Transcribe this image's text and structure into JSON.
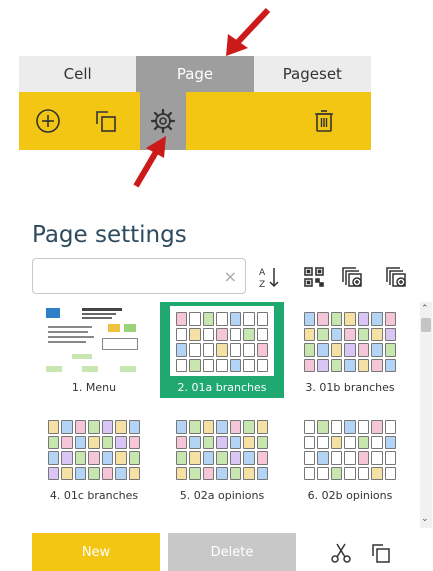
{
  "tabs": [
    {
      "label": "Cell"
    },
    {
      "label": "Page"
    },
    {
      "label": "Pageset"
    }
  ],
  "toolbar": {
    "icons": [
      "add-circle-icon",
      "copy-icon",
      "gear-icon",
      "trash-icon"
    ],
    "accent": "#f3c614",
    "active_bg": "#9e9e9e"
  },
  "page_settings": {
    "heading": "Page settings",
    "search": {
      "value": "",
      "placeholder": ""
    },
    "clear_symbol": "×",
    "tools": [
      "sort-az-icon",
      "qr-code-icon",
      "copy-to-pageset-icon",
      "add-pageset-icon"
    ]
  },
  "pages": [
    {
      "label": "1. Menu",
      "selected": false
    },
    {
      "label": "2. 01a branches",
      "selected": true
    },
    {
      "label": "3. 01b branches",
      "selected": false
    },
    {
      "label": "4. 01c branches",
      "selected": false
    },
    {
      "label": "5. 02a opinions",
      "selected": false
    },
    {
      "label": "6. 02b opinions",
      "selected": false
    }
  ],
  "buttons": {
    "new_label": "New",
    "delete_label": "Delete",
    "cut_icon": "scissors-icon",
    "copy_icon": "copy-icon"
  },
  "colors": {
    "selected": "#1fa870",
    "annotation_arrow": "#cc1a1a"
  }
}
